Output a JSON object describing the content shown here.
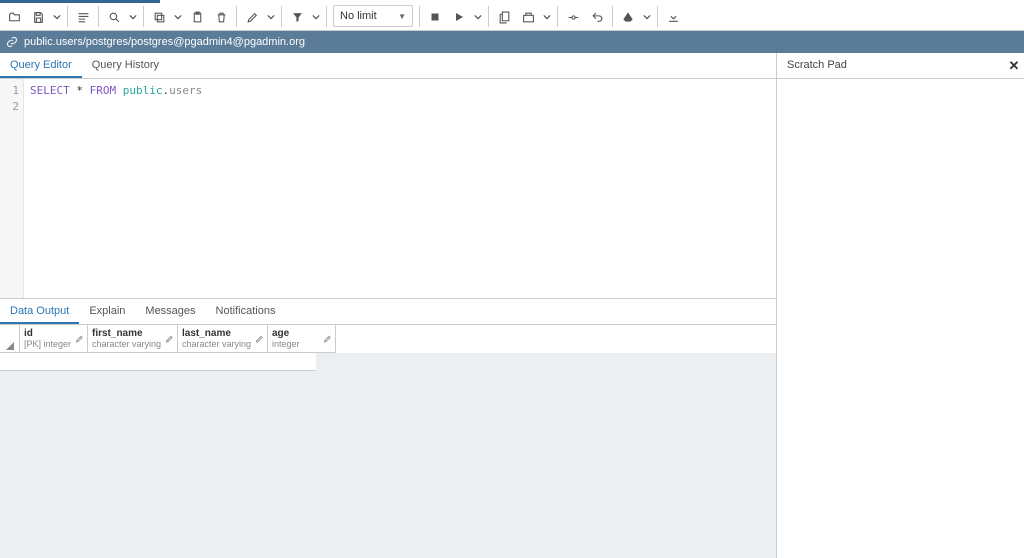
{
  "toolbar": {
    "limit_label": "No limit"
  },
  "context": {
    "path": "public.users/postgres/postgres@pgadmin4@pgadmin.org"
  },
  "tabs": {
    "editor": [
      "Query Editor",
      "Query History"
    ],
    "editor_active": 0,
    "output": [
      "Data Output",
      "Explain",
      "Messages",
      "Notifications"
    ],
    "output_active": 0
  },
  "scratch": {
    "label": "Scratch Pad"
  },
  "query": {
    "tokens": [
      {
        "t": "SELECT",
        "c": "kw"
      },
      {
        "t": " ",
        "c": "sp"
      },
      {
        "t": "*",
        "c": "op"
      },
      {
        "t": " ",
        "c": "sp"
      },
      {
        "t": "FROM",
        "c": "kw"
      },
      {
        "t": " ",
        "c": "sp"
      },
      {
        "t": "public",
        "c": "ns"
      },
      {
        "t": ".",
        "c": "op"
      },
      {
        "t": "users",
        "c": "ident"
      }
    ],
    "line_count": 2
  },
  "grid": {
    "columns": [
      {
        "name": "id",
        "type": "[PK] integer",
        "width": "narrow"
      },
      {
        "name": "first_name",
        "type": "character varying",
        "width": "wide"
      },
      {
        "name": "last_name",
        "type": "character varying",
        "width": "wide"
      },
      {
        "name": "age",
        "type": "integer",
        "width": "narrow"
      }
    ],
    "rows": []
  }
}
